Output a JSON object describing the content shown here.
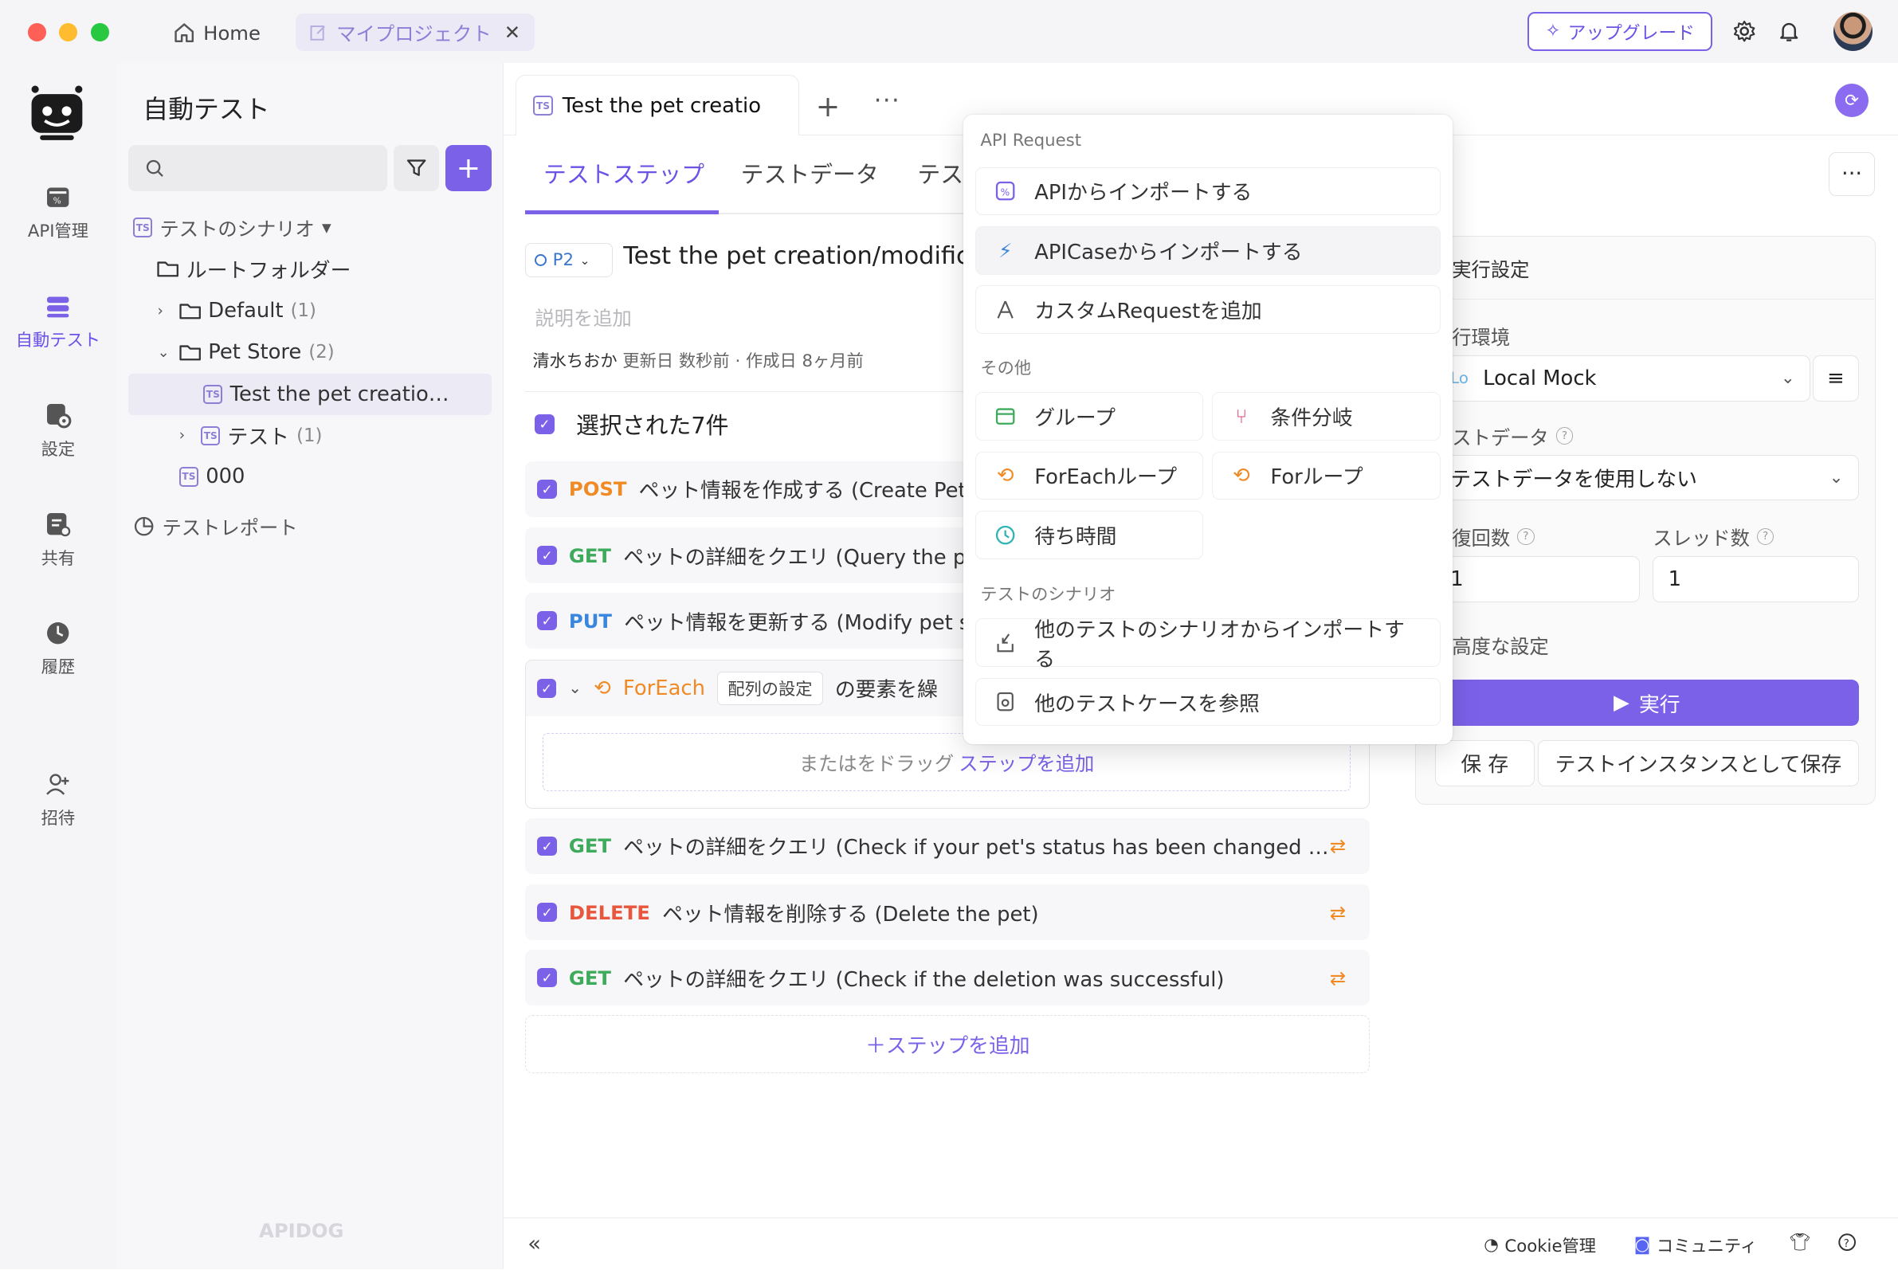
{
  "titlebar": {
    "home_label": "Home",
    "project_tab_label": "マイプロジェクト",
    "upgrade_label": "アップグレード"
  },
  "leftnav": {
    "items": [
      {
        "label": "API管理",
        "icon": "api-icon"
      },
      {
        "label": "自動テスト",
        "icon": "autotest-icon",
        "active": true
      },
      {
        "label": "設定",
        "icon": "settings-icon"
      },
      {
        "label": "共有",
        "icon": "share-icon"
      },
      {
        "label": "履歴",
        "icon": "history-icon"
      },
      {
        "label": "招待",
        "icon": "invite-icon"
      }
    ]
  },
  "sidebar": {
    "title": "自動テスト",
    "search_placeholder": "",
    "tree": {
      "scenarios_label": "テストのシナリオ",
      "root_folder": "ルートフォルダー",
      "default_folder": "Default",
      "default_count": "(1)",
      "pet_store_folder": "Pet Store",
      "pet_store_count": "(2)",
      "selected_case": "Test the pet creatio…",
      "test_folder": "テスト",
      "test_count": "(1)",
      "case_000": "000",
      "reports_label": "テストレポート"
    },
    "watermark": "APIDOG"
  },
  "main": {
    "doc_tab_label": "Test the pet creatio",
    "subtabs": [
      "テストステップ",
      "テストデータ",
      "テス"
    ],
    "priority": "P2",
    "case_title": "Test the pet creation/modifica",
    "description_placeholder": "説明を追加",
    "meta": {
      "author": "清水ちおか",
      "updated_label": "更新日",
      "updated_value": "数秒前",
      "created": "· 作成日 8ヶ月前"
    },
    "selected_count": "選択された7件",
    "steps": [
      {
        "method": "POST",
        "text": "ペット情報を作成する (Create Pet"
      },
      {
        "method": "GET",
        "text": "ペットの詳細をクエリ (Query the pe"
      },
      {
        "method": "PUT",
        "text": "ペット情報を更新する (Modify pet st"
      },
      {
        "method": "GET",
        "text": "ペットの詳細をクエリ (Check if your pet's status has been changed …"
      },
      {
        "method": "DELETE",
        "text": "ペット情報を削除する (Delete the pet)"
      },
      {
        "method": "GET",
        "text": "ペットの詳細をクエリ (Check if the deletion was successful)"
      }
    ],
    "foreach": {
      "label": "ForEach",
      "array_button": "配列の設定",
      "suffix": "の要素を繰",
      "drop_text": "またはをドラッグ",
      "drop_link": "ステップを追加"
    },
    "add_step": "＋ステップを追加"
  },
  "run_panel": {
    "header": "実行設定",
    "env_label": "行環境",
    "env_badge": "Lo",
    "env_value": "Local Mock",
    "data_label": "ストデータ",
    "data_value": "テストデータを使用しない",
    "loops_label": "復回数",
    "loops_value": "1",
    "threads_label": "スレッド数",
    "threads_value": "1",
    "advanced_label": "高度な設定",
    "run_label": "実行",
    "save_label": "保 存",
    "save_instance_label": "テストインスタンスとして保存"
  },
  "dropdown": {
    "api_section": "API Request",
    "import_api": "APIからインポートする",
    "import_apicase": "APICaseからインポートする",
    "custom_request": "カスタムRequestを追加",
    "other_section": "その他",
    "group": "グループ",
    "condition": "条件分岐",
    "foreach_loop": "ForEachループ",
    "for_loop": "Forループ",
    "wait": "待ち時間",
    "scenario_section": "テストのシナリオ",
    "import_scenario": "他のテストのシナリオからインポートする",
    "ref_case": "他のテストケースを参照"
  },
  "footer": {
    "cookie": "Cookie管理",
    "community": "コミュニティ"
  },
  "colors": {
    "accent": "#7b61e8",
    "post": "#f08a24",
    "get": "#3eaa5b",
    "put": "#3a86de",
    "delete": "#e8573d"
  }
}
